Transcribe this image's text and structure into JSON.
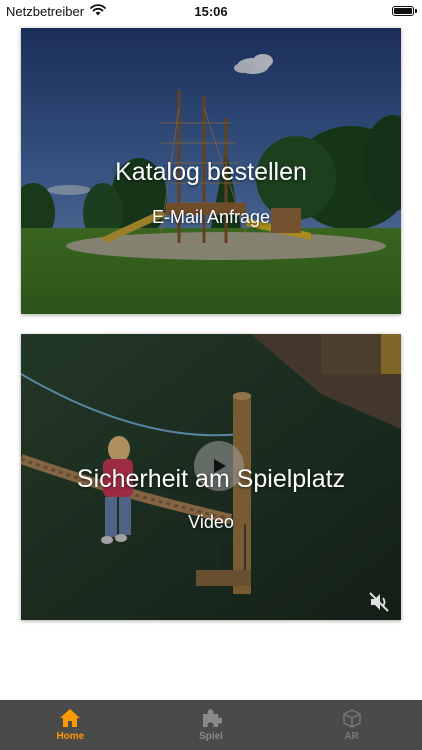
{
  "status_bar": {
    "carrier": "Netzbetreiber",
    "time": "15:06"
  },
  "cards": [
    {
      "title": "Katalog bestellen",
      "subtitle": "E-Mail Anfrage"
    },
    {
      "title": "Sicherheit am Spielplatz",
      "subtitle": "Video"
    }
  ],
  "tabs": [
    {
      "label": "Home",
      "icon": "house-icon",
      "active": true
    },
    {
      "label": "Spiel",
      "icon": "puzzle-icon",
      "active": false
    },
    {
      "label": "AR",
      "icon": "cube-icon",
      "active": false
    }
  ],
  "colors": {
    "tab_active": "#ff9900",
    "tab_inactive": "#8a8a8a",
    "tab_bar_bg": "#4a4a4a"
  }
}
